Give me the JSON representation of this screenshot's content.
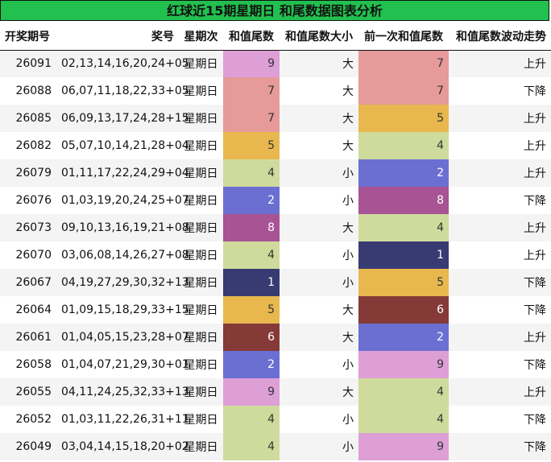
{
  "title": "红球近15期星期日 和尾数据图表分析",
  "headers": [
    "开奖期号",
    "奖号",
    "星期次",
    "和值尾数",
    "和值尾数大小",
    "前一次和值尾数",
    "和值尾数波动走势"
  ],
  "colors": {
    "title_bg": "#22c04e",
    "tail_1": "#383a72",
    "tail_2": "#6b6fd2",
    "tail_4": "#cfdb9c",
    "tail_5": "#e8b84e",
    "tail_6": "#853a38",
    "tail_7": "#e69a9a",
    "tail_8": "#a75394",
    "tail_9": "#dd9fd6"
  },
  "rows": [
    {
      "issue": "26091",
      "numbers": "02,13,14,16,20,24+05",
      "weekday": "星期日",
      "tail": "9",
      "size": "大",
      "prev": "7",
      "trend": "上升"
    },
    {
      "issue": "26088",
      "numbers": "06,07,11,18,22,33+05",
      "weekday": "星期日",
      "tail": "7",
      "size": "大",
      "prev": "7",
      "trend": "下降"
    },
    {
      "issue": "26085",
      "numbers": "06,09,13,17,24,28+15",
      "weekday": "星期日",
      "tail": "7",
      "size": "大",
      "prev": "5",
      "trend": "上升"
    },
    {
      "issue": "26082",
      "numbers": "05,07,10,14,21,28+04",
      "weekday": "星期日",
      "tail": "5",
      "size": "大",
      "prev": "4",
      "trend": "上升"
    },
    {
      "issue": "26079",
      "numbers": "01,11,17,22,24,29+04",
      "weekday": "星期日",
      "tail": "4",
      "size": "小",
      "prev": "2",
      "trend": "上升"
    },
    {
      "issue": "26076",
      "numbers": "01,03,19,20,24,25+07",
      "weekday": "星期日",
      "tail": "2",
      "size": "小",
      "prev": "8",
      "trend": "下降"
    },
    {
      "issue": "26073",
      "numbers": "09,10,13,16,19,21+08",
      "weekday": "星期日",
      "tail": "8",
      "size": "大",
      "prev": "4",
      "trend": "上升"
    },
    {
      "issue": "26070",
      "numbers": "03,06,08,14,26,27+08",
      "weekday": "星期日",
      "tail": "4",
      "size": "小",
      "prev": "1",
      "trend": "上升"
    },
    {
      "issue": "26067",
      "numbers": "04,19,27,29,30,32+13",
      "weekday": "星期日",
      "tail": "1",
      "size": "小",
      "prev": "5",
      "trend": "下降"
    },
    {
      "issue": "26064",
      "numbers": "01,09,15,18,29,33+15",
      "weekday": "星期日",
      "tail": "5",
      "size": "大",
      "prev": "6",
      "trend": "下降"
    },
    {
      "issue": "26061",
      "numbers": "01,04,05,15,23,28+07",
      "weekday": "星期日",
      "tail": "6",
      "size": "大",
      "prev": "2",
      "trend": "上升"
    },
    {
      "issue": "26058",
      "numbers": "01,04,07,21,29,30+01",
      "weekday": "星期日",
      "tail": "2",
      "size": "小",
      "prev": "9",
      "trend": "下降"
    },
    {
      "issue": "26055",
      "numbers": "04,11,24,25,32,33+13",
      "weekday": "星期日",
      "tail": "9",
      "size": "大",
      "prev": "4",
      "trend": "上升"
    },
    {
      "issue": "26052",
      "numbers": "01,03,11,22,26,31+11",
      "weekday": "星期日",
      "tail": "4",
      "size": "小",
      "prev": "4",
      "trend": "下降"
    },
    {
      "issue": "26049",
      "numbers": "03,04,14,15,18,20+02",
      "weekday": "星期日",
      "tail": "4",
      "size": "小",
      "prev": "9",
      "trend": "下降"
    }
  ]
}
